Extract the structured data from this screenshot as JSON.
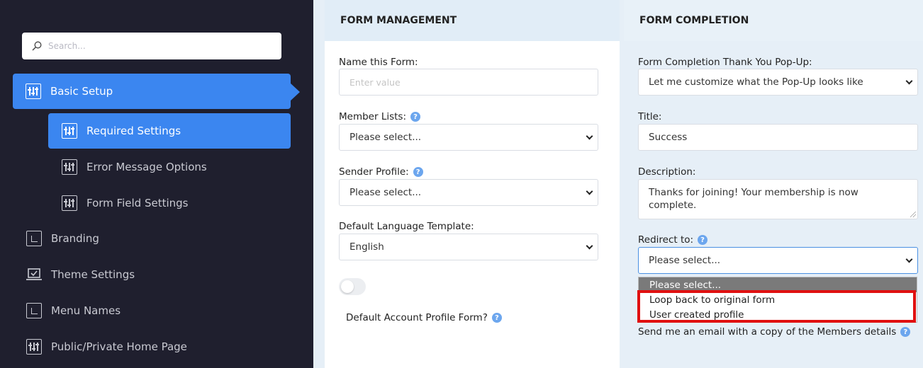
{
  "sidebar": {
    "search_placeholder": "Search...",
    "items": [
      {
        "label": "Basic Setup",
        "icon": "sliders-icon"
      },
      {
        "label": "Required Settings",
        "icon": "sliders-icon"
      },
      {
        "label": "Error Message Options",
        "icon": "sliders-icon"
      },
      {
        "label": "Form Field Settings",
        "icon": "sliders-icon"
      },
      {
        "label": "Branding",
        "icon": "frame-icon"
      },
      {
        "label": "Theme Settings",
        "icon": "laptop-check-icon"
      },
      {
        "label": "Menu Names",
        "icon": "frame-icon"
      },
      {
        "label": "Public/Private Home Page",
        "icon": "sliders-icon"
      }
    ]
  },
  "form_management": {
    "heading": "FORM MANAGEMENT",
    "name_label": "Name this Form:",
    "name_placeholder": "Enter value",
    "member_lists_label": "Member Lists:",
    "member_lists_value": "Please select...",
    "sender_profile_label": "Sender Profile:",
    "sender_profile_value": "Please select...",
    "language_label": "Default Language Template:",
    "language_value": "English",
    "default_profile_label": "Default Account Profile Form?"
  },
  "form_completion": {
    "heading": "FORM COMPLETION",
    "popup_label": "Form Completion Thank You Pop-Up:",
    "popup_value": "Let me customize what the Pop-Up looks like",
    "title_label": "Title:",
    "title_value": "Success",
    "description_label": "Description:",
    "description_value": "Thanks for joining! Your membership is now complete.",
    "redirect_label": "Redirect to:",
    "redirect_value": "Please select...",
    "redirect_options": [
      "Please select...",
      "Loop back to original form",
      "User created profile"
    ],
    "email_copy_label": "Send me an email with a copy of the Members details"
  },
  "colors": {
    "sidebar_bg": "#1f1f2e",
    "accent": "#3b86f0",
    "highlight": "#e01010"
  }
}
